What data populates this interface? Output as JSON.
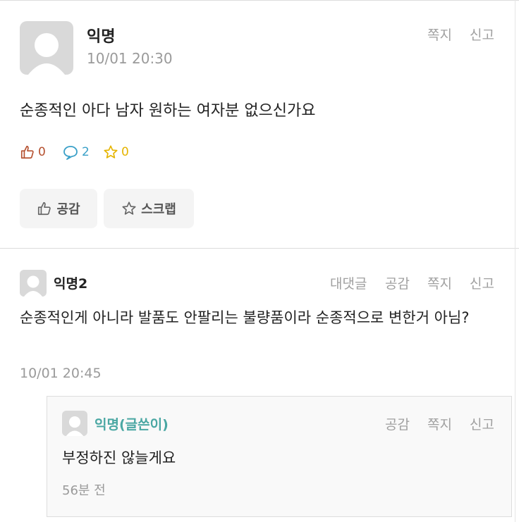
{
  "post": {
    "author": "익명",
    "timestamp": "10/01 20:30",
    "actions": {
      "message": "쪽지",
      "report": "신고"
    },
    "body": "순종적인 아다 남자 원하는 여자분 없으신가요",
    "stats": {
      "likes": "0",
      "comments": "2",
      "scraps": "0"
    },
    "buttons": {
      "like": "공감",
      "scrap": "스크랩"
    }
  },
  "comment": {
    "author": "익명2",
    "actions": {
      "reply": "대댓글",
      "like": "공감",
      "message": "쪽지",
      "report": "신고"
    },
    "body": "순종적인게 아니라 발품도 안팔리는 불량품이라 순종적으로 변한거 아님?",
    "timestamp": "10/01 20:45"
  },
  "reply": {
    "author": "익명(글쓴이)",
    "actions": {
      "like": "공감",
      "message": "쪽지",
      "report": "신고"
    },
    "body": "부정하진 않늘게요",
    "timestamp": "56분 전"
  },
  "colors": {
    "like": "#b5502f",
    "comment": "#3aa0c8",
    "scrap": "#e5b400",
    "op_name": "#4aa7a3"
  }
}
